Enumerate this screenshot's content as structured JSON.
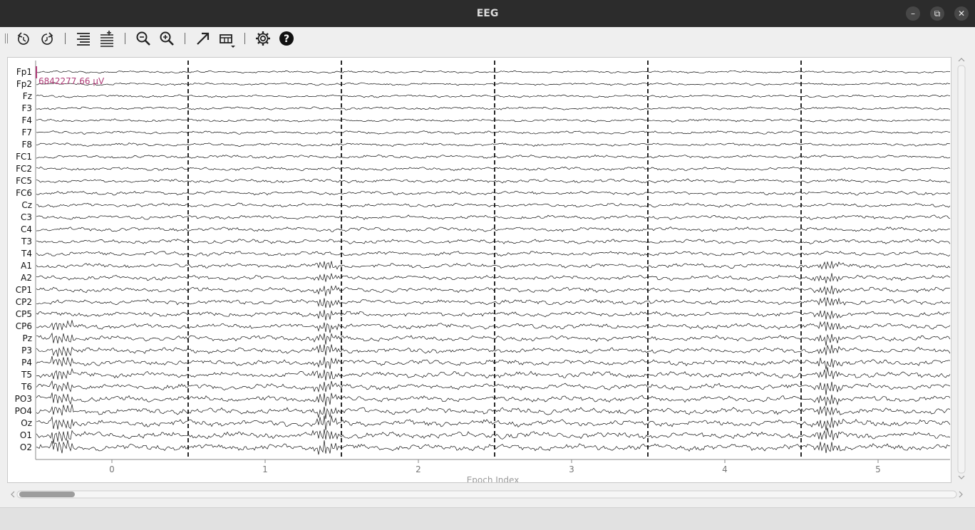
{
  "window": {
    "title": "EEG",
    "controls": {
      "minimize": "–",
      "maximize": "⧉",
      "close": "✕"
    }
  },
  "toolbar": {
    "buttons": [
      {
        "name": "history-back-icon"
      },
      {
        "name": "history-forward-icon"
      },
      {
        "name": "fewer-channels-icon"
      },
      {
        "name": "more-channels-icon"
      },
      {
        "name": "zoom-out-icon"
      },
      {
        "name": "zoom-in-icon"
      },
      {
        "name": "fullscreen-arrow-icon"
      },
      {
        "name": "projector-dropdown-icon"
      },
      {
        "name": "settings-gear-icon"
      },
      {
        "name": "help-icon"
      }
    ]
  },
  "plot": {
    "channels": [
      "Fp1",
      "Fp2",
      "Fz",
      "F3",
      "F4",
      "F7",
      "F8",
      "FC1",
      "FC2",
      "FC5",
      "FC6",
      "Cz",
      "C3",
      "C4",
      "T3",
      "T4",
      "A1",
      "A2",
      "CP1",
      "CP2",
      "CP5",
      "CP6",
      "Pz",
      "P3",
      "P4",
      "T5",
      "T6",
      "PO3",
      "PO4",
      "Oz",
      "O1",
      "O2"
    ],
    "x_ticks": [
      "0",
      "1",
      "2",
      "3",
      "4",
      "5"
    ],
    "xlabel": "Epoch Index",
    "scale_label": "6842277.66 μV",
    "scale_color": "#b03c78",
    "epoch_count_visible": 6
  }
}
